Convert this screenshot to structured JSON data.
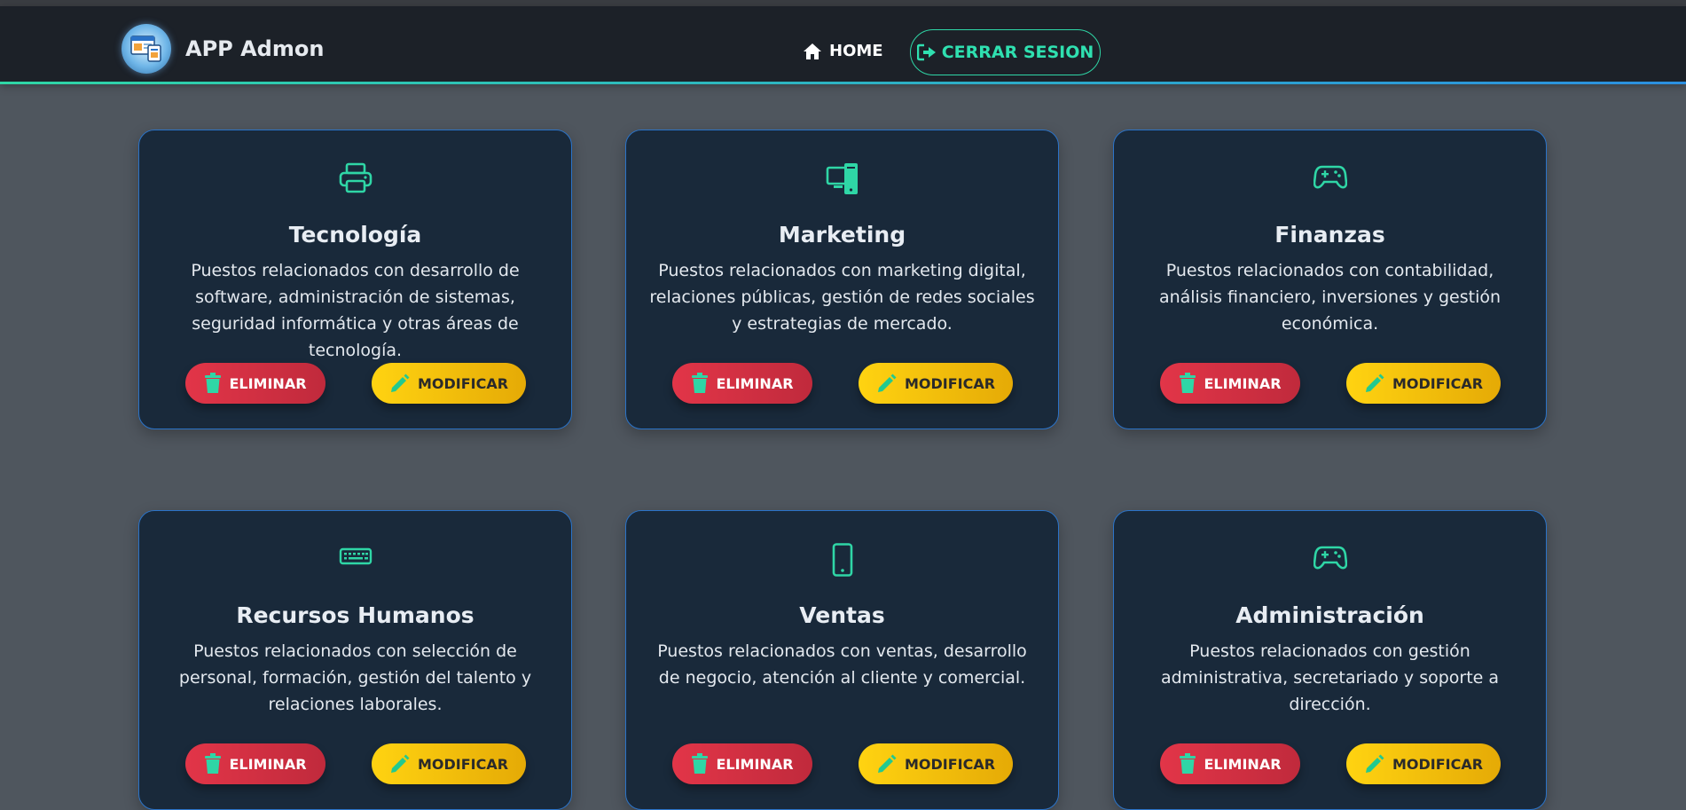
{
  "app": {
    "title": "APP Admon"
  },
  "nav": {
    "home_label": "HOME",
    "logout_label": "CERRAR SESION"
  },
  "colors": {
    "accent": "#2fd6a6",
    "card_border": "#2b73c8",
    "delete": "#e23548",
    "edit": "#ffd311"
  },
  "cards": [
    {
      "icon": "printer-icon",
      "title": "Tecnología",
      "description": "Puestos relacionados con desarrollo de software, administración de sistemas, seguridad informática y otras áreas de tecnología.",
      "delete_label": "ELIMINAR",
      "edit_label": "MODIFICAR"
    },
    {
      "icon": "desktop-mobile-icon",
      "title": "Marketing",
      "description": "Puestos relacionados con marketing digital, relaciones públicas, gestión de redes sociales y estrategias de mercado.",
      "delete_label": "ELIMINAR",
      "edit_label": "MODIFICAR"
    },
    {
      "icon": "gamepad-icon",
      "title": "Finanzas",
      "description": "Puestos relacionados con contabilidad, análisis financiero, inversiones y gestión económica.",
      "delete_label": "ELIMINAR",
      "edit_label": "MODIFICAR"
    },
    {
      "icon": "keyboard-icon",
      "title": "Recursos Humanos",
      "description": "Puestos relacionados con selección de personal, formación, gestión del talento y relaciones laborales.",
      "delete_label": "ELIMINAR",
      "edit_label": "MODIFICAR"
    },
    {
      "icon": "mobile-phone-icon",
      "title": "Ventas",
      "description": "Puestos relacionados con ventas, desarrollo de negocio, atención al cliente y comercial.",
      "delete_label": "ELIMINAR",
      "edit_label": "MODIFICAR"
    },
    {
      "icon": "gamepad-icon",
      "title": "Administración",
      "description": "Puestos relacionados con gestión administrativa, secretariado y soporte a dirección.",
      "delete_label": "ELIMINAR",
      "edit_label": "MODIFICAR"
    }
  ]
}
